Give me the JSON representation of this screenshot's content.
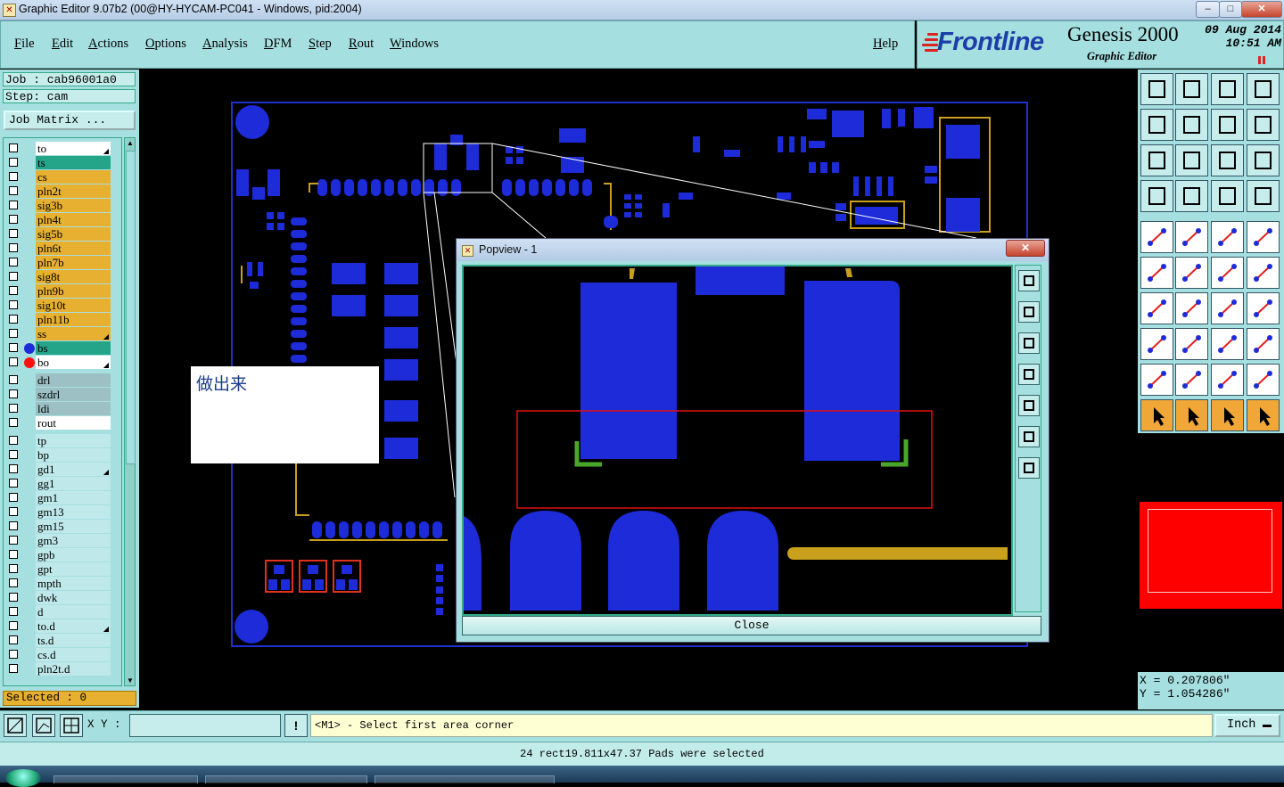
{
  "window": {
    "title": "Graphic Editor 9.07b2 (00@HY-HYCAM-PC041 - Windows, pid:2004)",
    "minimize": "–",
    "maximize": "□",
    "close": "✕"
  },
  "menu": {
    "items": [
      "File",
      "Edit",
      "Actions",
      "Options",
      "Analysis",
      "DFM",
      "Step",
      "Rout",
      "Windows"
    ],
    "help": "Help"
  },
  "brand": {
    "logo": "Frontline",
    "product": "Genesis 2000",
    "subtitle": "Graphic Editor",
    "date": "09  Aug  2014",
    "time": "10:51  AM"
  },
  "job": {
    "job_label": "Job : cab96001a0",
    "step_label": "Step: cam",
    "matrix_button": "Job Matrix ..."
  },
  "layers": [
    {
      "name": "to",
      "color": "#ffffff",
      "arrow": true
    },
    {
      "name": "ts",
      "color": "#24a58a"
    },
    {
      "name": "cs",
      "color": "#e8b030"
    },
    {
      "name": "pln2t",
      "color": "#e8b030"
    },
    {
      "name": "sig3b",
      "color": "#e8b030"
    },
    {
      "name": "pln4t",
      "color": "#e8b030"
    },
    {
      "name": "sig5b",
      "color": "#e8b030"
    },
    {
      "name": "pln6t",
      "color": "#e8b030"
    },
    {
      "name": "pln7b",
      "color": "#e8b030"
    },
    {
      "name": "sig8t",
      "color": "#e8b030"
    },
    {
      "name": "pln9b",
      "color": "#e8b030"
    },
    {
      "name": "sig10t",
      "color": "#e8b030"
    },
    {
      "name": "pln11b",
      "color": "#e8b030"
    },
    {
      "name": "ss",
      "color": "#e8b030",
      "arrow": true
    },
    {
      "name": "bs",
      "color": "#24a58a",
      "dot": "#1d2bd8"
    },
    {
      "name": "bo",
      "color": "#ffffff",
      "dot": "#ff1010",
      "arrow": true
    },
    {
      "name": "drl",
      "color": "#9cc0c4",
      "gap": true
    },
    {
      "name": "szdrl",
      "color": "#9cc0c4"
    },
    {
      "name": "ldi",
      "color": "#9cc0c4"
    },
    {
      "name": "rout",
      "color": "#ffffff"
    },
    {
      "name": "tp",
      "color": "#bfe8ea",
      "gap": true
    },
    {
      "name": "bp",
      "color": "#bfe8ea"
    },
    {
      "name": "gd1",
      "color": "#bfe8ea",
      "arrow": true
    },
    {
      "name": "gg1",
      "color": "#bfe8ea"
    },
    {
      "name": "gm1",
      "color": "#bfe8ea"
    },
    {
      "name": "gm13",
      "color": "#bfe8ea"
    },
    {
      "name": "gm15",
      "color": "#bfe8ea"
    },
    {
      "name": "gm3",
      "color": "#bfe8ea"
    },
    {
      "name": "gpb",
      "color": "#bfe8ea"
    },
    {
      "name": "gpt",
      "color": "#bfe8ea"
    },
    {
      "name": "mpth",
      "color": "#bfe8ea"
    },
    {
      "name": "dwk",
      "color": "#bfe8ea"
    },
    {
      "name": "d",
      "color": "#bfe8ea"
    },
    {
      "name": "to.d",
      "color": "#bfe8ea",
      "arrow": true
    },
    {
      "name": "ts.d",
      "color": "#bfe8ea"
    },
    {
      "name": "cs.d",
      "color": "#bfe8ea"
    },
    {
      "name": "pln2t.d",
      "color": "#bfe8ea"
    }
  ],
  "selected": "Selected : 0",
  "note": "做出来",
  "popview": {
    "title": "Popview - 1",
    "close_x": "✕",
    "close_button": "Close"
  },
  "coords": {
    "x": "X  =  0.207806\"",
    "y": "Y  =  1.054286\""
  },
  "bottom": {
    "xy_label": "X Y :",
    "xy_value": "",
    "prompt_icon": "!",
    "prompt": "<M1> - Select first area corner",
    "units": "Inch"
  },
  "status": "24 rect19.811x47.37 Pads were selected",
  "colors": {
    "panel": "#a6dfe0",
    "pad_blue": "#1d2bd8",
    "silk_yellow": "#c9a01c",
    "outline_blue": "#2030d0",
    "select_red": "#e01010"
  }
}
